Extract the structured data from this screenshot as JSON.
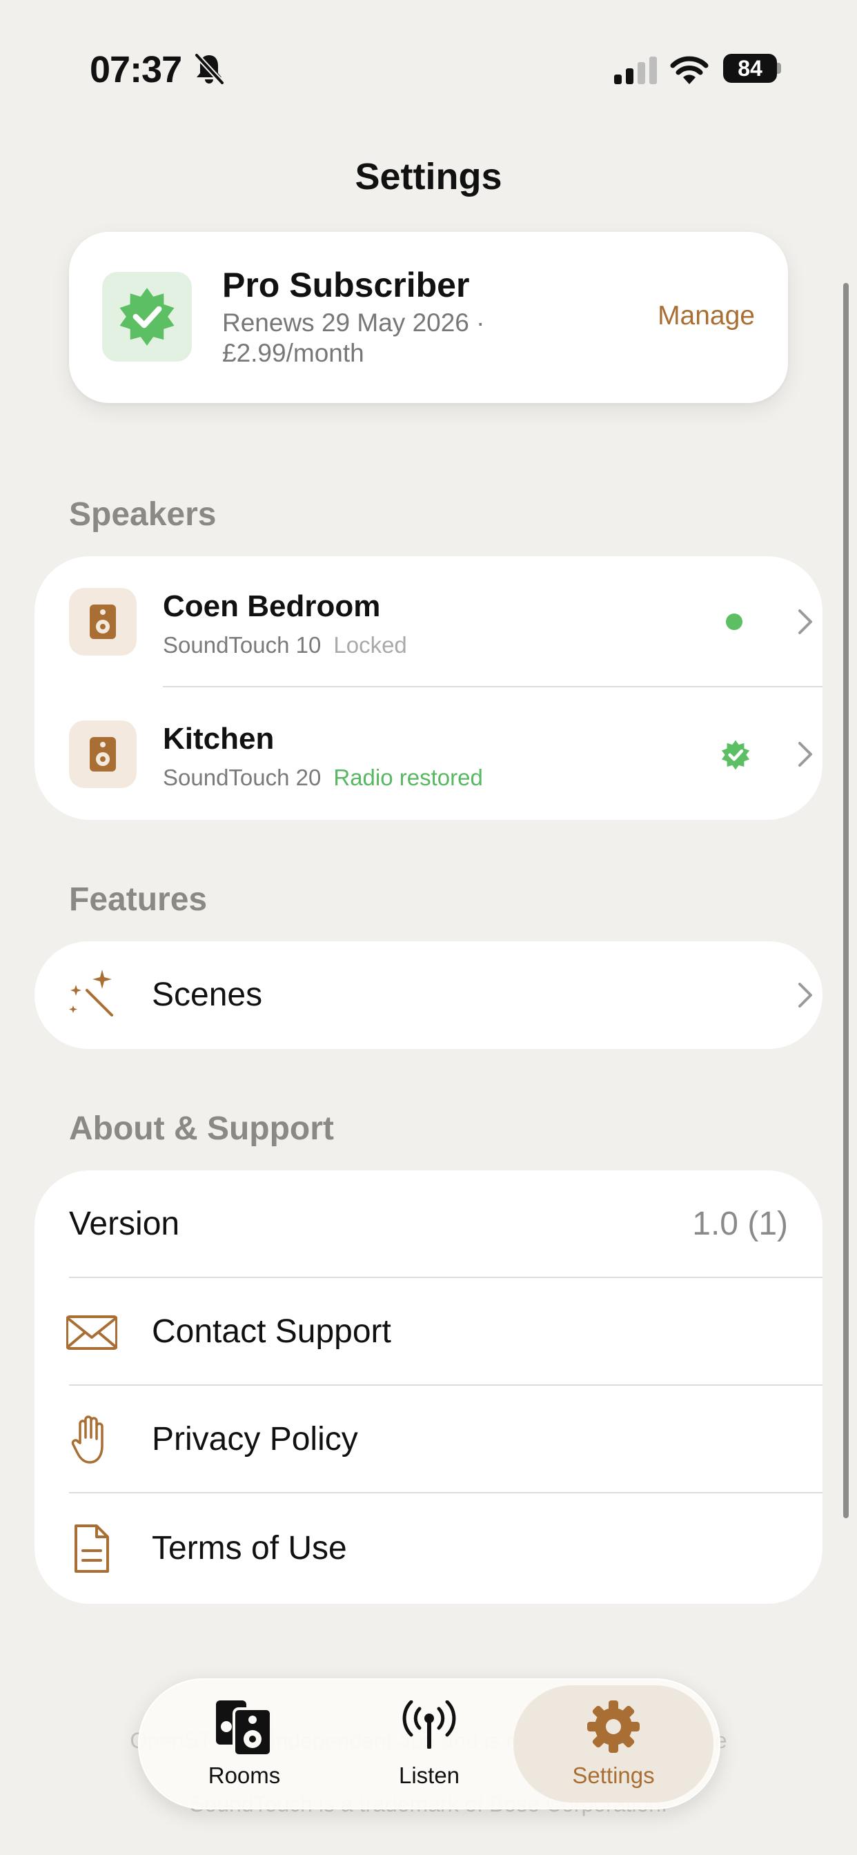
{
  "status_bar": {
    "time": "07:37",
    "battery": "84"
  },
  "page": {
    "title": "Settings"
  },
  "subscription": {
    "title": "Pro Subscriber",
    "detail": "Renews 29 May 2026 · £2.99/month",
    "manage_label": "Manage"
  },
  "speakers": {
    "section_title": "Speakers",
    "items": [
      {
        "name": "Coen Bedroom",
        "model": "SoundTouch 10",
        "status": "Locked"
      },
      {
        "name": "Kitchen",
        "model": "SoundTouch 20",
        "status": "Radio restored"
      }
    ]
  },
  "features": {
    "section_title": "Features",
    "items": [
      {
        "label": "Scenes",
        "icon": "magic-wand-icon"
      }
    ]
  },
  "about": {
    "section_title": "About & Support",
    "version_label": "Version",
    "version_value": "1.0 (1)",
    "items": [
      {
        "label": "Contact Support",
        "icon": "envelope-icon"
      },
      {
        "label": "Privacy Policy",
        "icon": "hand-icon"
      },
      {
        "label": "Terms of Use",
        "icon": "document-icon"
      }
    ]
  },
  "footer": {
    "line1": "OpenST is an independent app and is not affiliated with Bose",
    "line2": "SoundTouch is a trademark of Bose Corporation."
  },
  "tabs": [
    {
      "label": "Rooms",
      "icon": "speakers-icon"
    },
    {
      "label": "Listen",
      "icon": "antenna-icon"
    },
    {
      "label": "Settings",
      "icon": "gear-icon",
      "active": true
    }
  ],
  "colors": {
    "accent": "#a96e33",
    "success": "#5cbf63",
    "background": "#f2f0ec",
    "icon_bg": "#f4e9df"
  }
}
